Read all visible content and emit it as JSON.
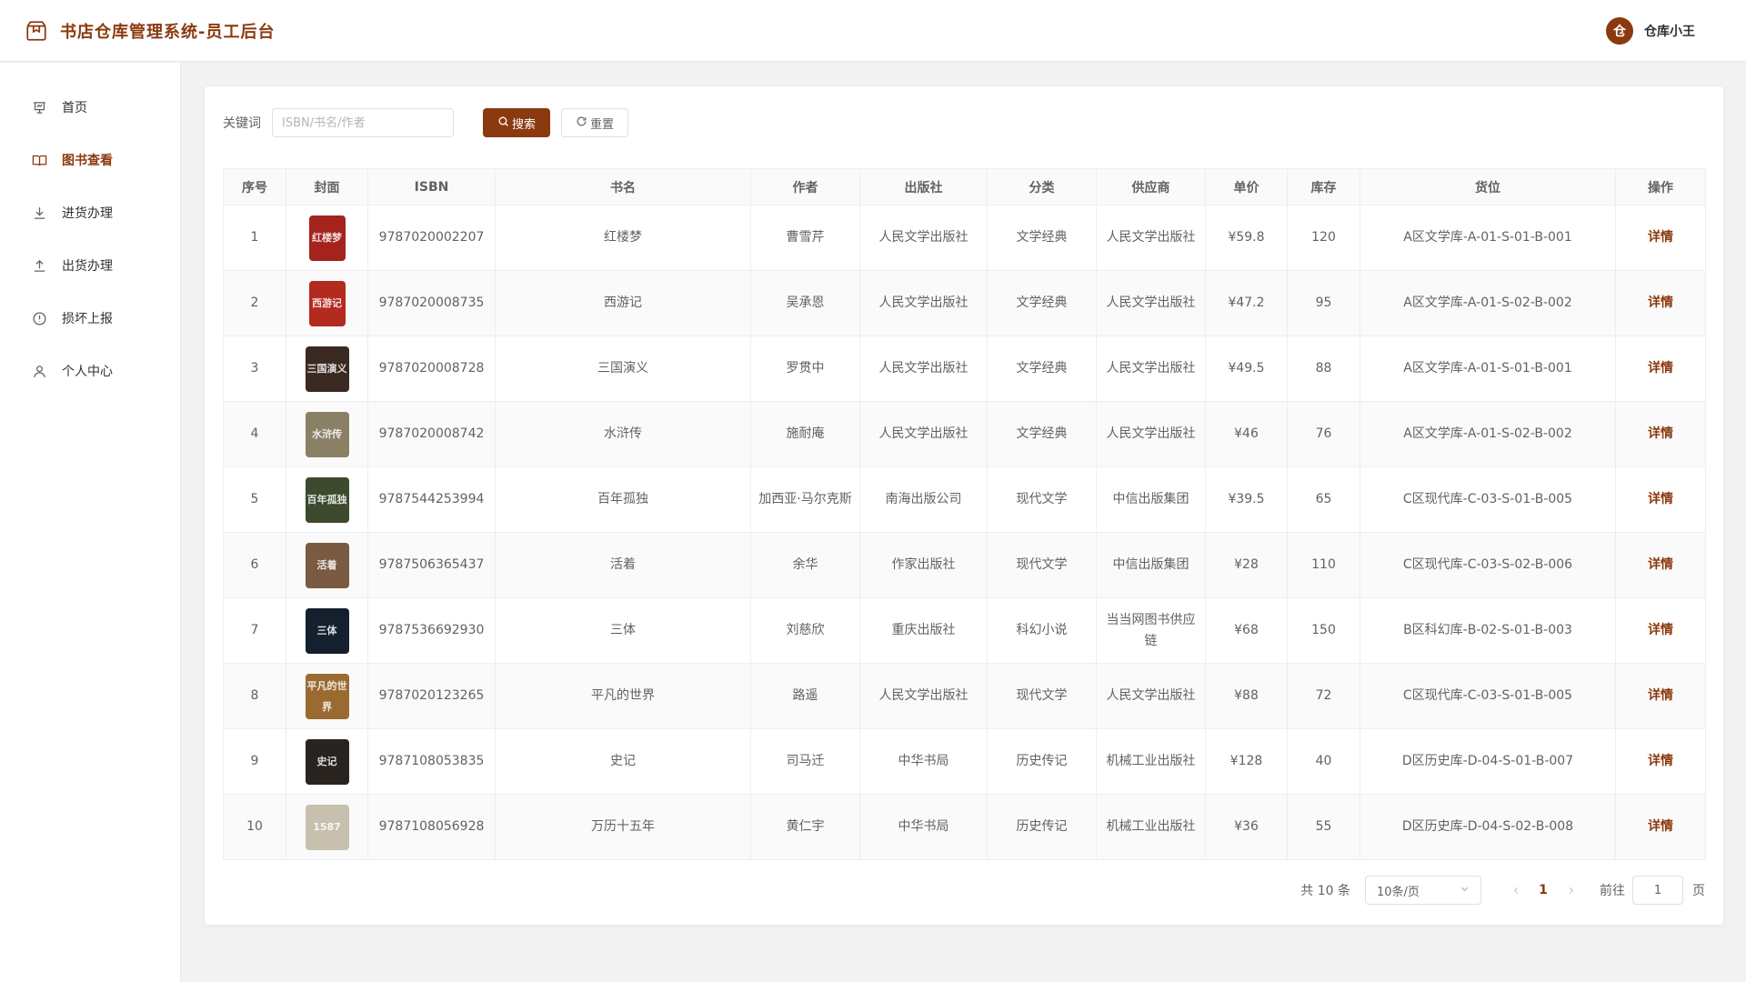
{
  "header": {
    "title": "书店仓库管理系统-员工后台",
    "avatar_char": "仓",
    "username": "仓库小王"
  },
  "sidebar": {
    "items": [
      {
        "label": "首页",
        "icon": "presentation-icon"
      },
      {
        "label": "图书查看",
        "icon": "book-open-icon",
        "active": true
      },
      {
        "label": "进货办理",
        "icon": "download-icon"
      },
      {
        "label": "出货办理",
        "icon": "upload-icon"
      },
      {
        "label": "损坏上报",
        "icon": "warning-circle-icon"
      },
      {
        "label": "个人中心",
        "icon": "user-icon"
      }
    ]
  },
  "search": {
    "label": "关键词",
    "placeholder": "ISBN/书名/作者",
    "value": "",
    "search_btn": "搜索",
    "reset_btn": "重置"
  },
  "table": {
    "headers": [
      "序号",
      "封面",
      "ISBN",
      "书名",
      "作者",
      "出版社",
      "分类",
      "供应商",
      "单价",
      "库存",
      "货位",
      "操作"
    ],
    "rows": [
      {
        "no": "1",
        "cover_color": "#a4231d",
        "cover_text": "红楼梦",
        "isbn": "9787020002207",
        "title": "红楼梦",
        "author": "曹雪芹",
        "publisher": "人民文学出版社",
        "category": "文学经典",
        "supplier": "人民文学出版社",
        "price": "¥59.8",
        "stock": "120",
        "location": "A区文学库-A-01-S-01-B-001",
        "action": "详情"
      },
      {
        "no": "2",
        "cover_color": "#b32a1f",
        "cover_text": "西游记",
        "isbn": "9787020008735",
        "title": "西游记",
        "author": "吴承恩",
        "publisher": "人民文学出版社",
        "category": "文学经典",
        "supplier": "人民文学出版社",
        "price": "¥47.2",
        "stock": "95",
        "location": "A区文学库-A-01-S-02-B-002",
        "action": "详情"
      },
      {
        "no": "3",
        "cover_color": "#3a2a22",
        "cover_text": "三国演义",
        "isbn": "9787020008728",
        "title": "三国演义",
        "author": "罗贯中",
        "publisher": "人民文学出版社",
        "category": "文学经典",
        "supplier": "人民文学出版社",
        "price": "¥49.5",
        "stock": "88",
        "location": "A区文学库-A-01-S-01-B-001",
        "action": "详情"
      },
      {
        "no": "4",
        "cover_color": "#8a8066",
        "cover_text": "水浒传",
        "isbn": "9787020008742",
        "title": "水浒传",
        "author": "施耐庵",
        "publisher": "人民文学出版社",
        "category": "文学经典",
        "supplier": "人民文学出版社",
        "price": "¥46",
        "stock": "76",
        "location": "A区文学库-A-01-S-02-B-002",
        "action": "详情"
      },
      {
        "no": "5",
        "cover_color": "#3d4a2e",
        "cover_text": "百年孤独",
        "isbn": "9787544253994",
        "title": "百年孤独",
        "author": "加西亚·马尔克斯",
        "publisher": "南海出版公司",
        "category": "现代文学",
        "supplier": "中信出版集团",
        "price": "¥39.5",
        "stock": "65",
        "location": "C区现代库-C-03-S-01-B-005",
        "action": "详情"
      },
      {
        "no": "6",
        "cover_color": "#7a5a40",
        "cover_text": "活着",
        "isbn": "9787506365437",
        "title": "活着",
        "author": "余华",
        "publisher": "作家出版社",
        "category": "现代文学",
        "supplier": "中信出版集团",
        "price": "¥28",
        "stock": "110",
        "location": "C区现代库-C-03-S-02-B-006",
        "action": "详情"
      },
      {
        "no": "7",
        "cover_color": "#14202e",
        "cover_text": "三体",
        "isbn": "9787536692930",
        "title": "三体",
        "author": "刘慈欣",
        "publisher": "重庆出版社",
        "category": "科幻小说",
        "supplier": "当当网图书供应链",
        "price": "¥68",
        "stock": "150",
        "location": "B区科幻库-B-02-S-01-B-003",
        "action": "详情"
      },
      {
        "no": "8",
        "cover_color": "#9a6a30",
        "cover_text": "平凡的世界",
        "isbn": "9787020123265",
        "title": "平凡的世界",
        "author": "路遥",
        "publisher": "人民文学出版社",
        "category": "现代文学",
        "supplier": "人民文学出版社",
        "price": "¥88",
        "stock": "72",
        "location": "C区现代库-C-03-S-01-B-005",
        "action": "详情"
      },
      {
        "no": "9",
        "cover_color": "#2a2420",
        "cover_text": "史记",
        "isbn": "9787108053835",
        "title": "史记",
        "author": "司马迁",
        "publisher": "中华书局",
        "category": "历史传记",
        "supplier": "机械工业出版社",
        "price": "¥128",
        "stock": "40",
        "location": "D区历史库-D-04-S-01-B-007",
        "action": "详情"
      },
      {
        "no": "10",
        "cover_color": "#c8c0ae",
        "cover_text": "1587",
        "isbn": "9787108056928",
        "title": "万历十五年",
        "author": "黄仁宇",
        "publisher": "中华书局",
        "category": "历史传记",
        "supplier": "机械工业出版社",
        "price": "¥36",
        "stock": "55",
        "location": "D区历史库-D-04-S-02-B-008",
        "action": "详情"
      }
    ]
  },
  "pagination": {
    "total": "共 10 条",
    "page_size": "10条/页",
    "current_page": "1",
    "goto_label": "前往",
    "goto_value": "1",
    "page_unit": "页"
  },
  "colors": {
    "accent": "#8b3a0f",
    "background": "#f2f2f2"
  }
}
